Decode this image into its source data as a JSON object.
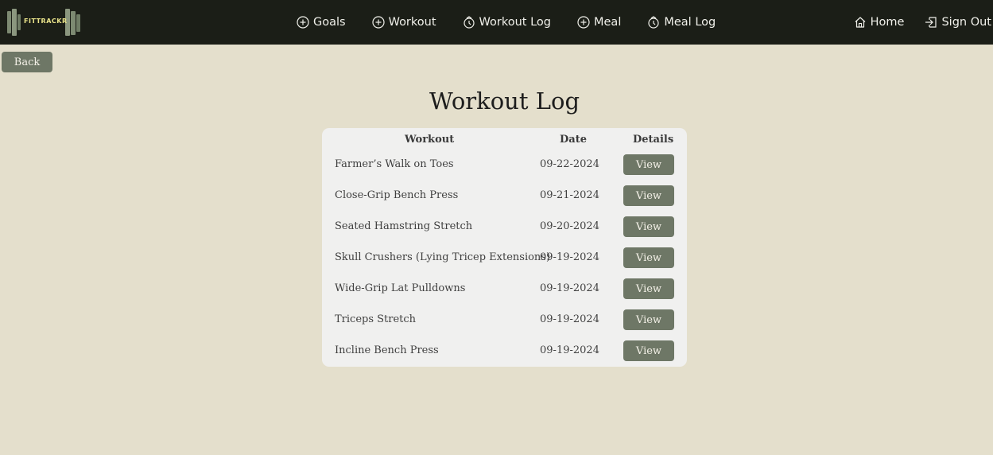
{
  "brand": {
    "logo_text": "FITTRACKR"
  },
  "nav": {
    "items": [
      {
        "label": "Goals",
        "icon": "plus-circle-icon"
      },
      {
        "label": "Workout",
        "icon": "plus-circle-icon"
      },
      {
        "label": "Workout Log",
        "icon": "log-icon"
      },
      {
        "label": "Meal",
        "icon": "plus-circle-icon"
      },
      {
        "label": "Meal Log",
        "icon": "log-icon"
      }
    ],
    "right": [
      {
        "label": "Home",
        "icon": "home-icon"
      },
      {
        "label": "Sign Out",
        "icon": "sign-out-icon"
      }
    ]
  },
  "back_label": "Back",
  "page_title": "Workout Log",
  "table": {
    "headers": {
      "workout": "Workout",
      "date": "Date",
      "details": "Details"
    },
    "rows": [
      {
        "workout": "Farmer’s Walk on Toes",
        "date": "09-22-2024",
        "action": "View"
      },
      {
        "workout": "Close-Grip Bench Press",
        "date": "09-21-2024",
        "action": "View"
      },
      {
        "workout": "Seated Hamstring Stretch",
        "date": "09-20-2024",
        "action": "View"
      },
      {
        "workout": "Skull Crushers (Lying Tricep Extensions)",
        "date": "09-19-2024",
        "action": "View"
      },
      {
        "workout": "Wide-Grip Lat Pulldowns",
        "date": "09-19-2024",
        "action": "View"
      },
      {
        "workout": "Triceps Stretch",
        "date": "09-19-2024",
        "action": "View"
      },
      {
        "workout": "Incline Bench Press",
        "date": "09-19-2024",
        "action": "View"
      }
    ]
  },
  "colors": {
    "navbar_bg": "#1b1e17",
    "page_bg": "#e4dfcc",
    "button_bg": "#6e7766",
    "card_bg": "#f0f0ef",
    "logo_accent": "#e9e38a"
  }
}
